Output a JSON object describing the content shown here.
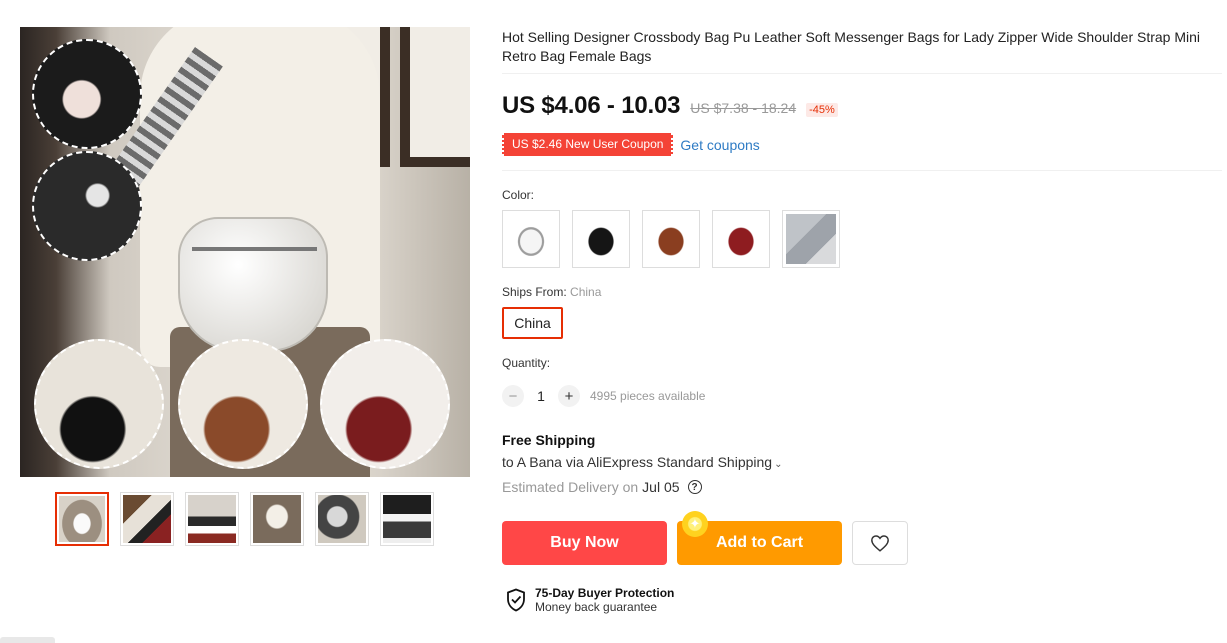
{
  "product": {
    "title": "Hot Selling Designer Crossbody Bag Pu Leather Soft Messenger Bags for Lady Zipper Wide Shoulder Strap Mini Retro Bag Female Bags",
    "price": "US $4.06 - 10.03",
    "original_price": "US $7.38 - 18.24",
    "discount": "-45%"
  },
  "coupon": {
    "label": "US $2.46 New User Coupon",
    "link": "Get coupons"
  },
  "color": {
    "label": "Color:",
    "swatches": [
      {
        "name": "white",
        "swatch_color": "#f5f5f5"
      },
      {
        "name": "black",
        "swatch_color": "#151515"
      },
      {
        "name": "brown",
        "swatch_color": "#8a3e20"
      },
      {
        "name": "red",
        "swatch_color": "#8e1c20"
      },
      {
        "name": "gray",
        "swatch_color": "#bfc3c8"
      }
    ]
  },
  "ships_from": {
    "label": "Ships From:",
    "selected": "China",
    "option": "China"
  },
  "quantity": {
    "label": "Quantity:",
    "value": "1",
    "minus": "−",
    "plus": "+",
    "available": "4995 pieces available"
  },
  "shipping": {
    "title": "Free Shipping",
    "via": "to A Bana via AliExpress Standard Shipping",
    "delivery_label": "Estimated Delivery on",
    "delivery_date": "Jul 05",
    "help_icon": "?"
  },
  "actions": {
    "buy_now": "Buy Now",
    "add_to_cart": "Add to Cart"
  },
  "protection": {
    "title": "75-Day Buyer Protection",
    "subtitle": "Money back guarantee"
  },
  "colors": {
    "buy_now": "#ff4747",
    "add_to_cart": "#ff9a00",
    "coupon": "#f44336",
    "link": "#2e7bc4",
    "accent": "#e62e04"
  },
  "gallery": {
    "thumbnails": 6,
    "active_index": 0
  }
}
